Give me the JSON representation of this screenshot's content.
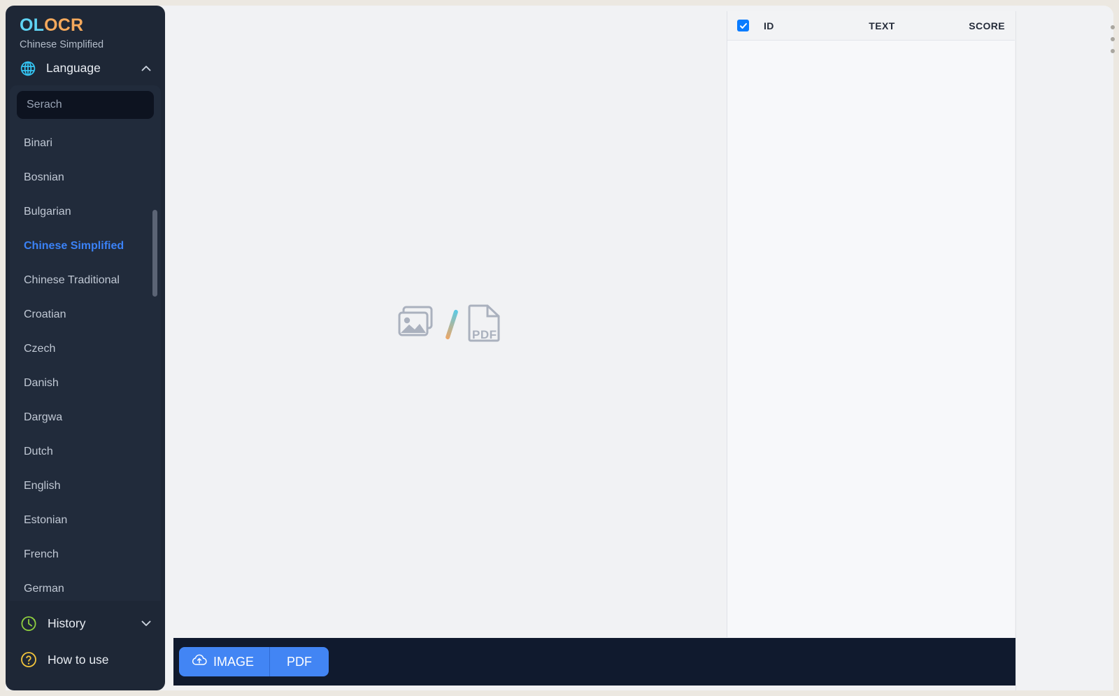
{
  "brand": {
    "logo_part_a": "OL",
    "logo_part_b": "OCR",
    "subtitle": "Chinese Simplified",
    "accent_cyan": "#5fd3f3",
    "accent_orange": "#f5a95c"
  },
  "sidebar": {
    "language_section": {
      "label": "Language",
      "icon": "globe-icon",
      "chevron": "chevron-up-icon",
      "expanded": true,
      "search_placeholder": "Serach",
      "search_value": "",
      "selected": "Chinese Simplified",
      "items": [
        "Binari",
        "Bosnian",
        "Bulgarian",
        "Chinese Simplified",
        "Chinese Traditional",
        "Croatian",
        "Czech",
        "Danish",
        "Dargwa",
        "Dutch",
        "English",
        "Estonian",
        "French",
        "German"
      ]
    },
    "history": {
      "label": "History",
      "icon": "clock-icon",
      "chevron": "chevron-down-icon",
      "icon_color": "#8fcf3f"
    },
    "how_to_use": {
      "label": "How to use",
      "icon": "question-circle-icon",
      "icon_color": "#f2c43c"
    }
  },
  "viewer": {
    "placeholder_image_icon": "image-stack-icon",
    "placeholder_separator": "slash-divider",
    "placeholder_pdf_icon": "pdf-file-icon",
    "pdf_label": "PDF"
  },
  "results": {
    "select_all_checked": true,
    "columns": {
      "id": "ID",
      "text": "TEXT",
      "score": "SCORE"
    },
    "rows": []
  },
  "bottom_bar": {
    "image_button": "IMAGE",
    "image_button_icon": "cloud-upload-icon",
    "pdf_button": "PDF",
    "button_color": "#4285f4"
  },
  "window": {
    "resize_grip": "vertical-dots-grip"
  }
}
